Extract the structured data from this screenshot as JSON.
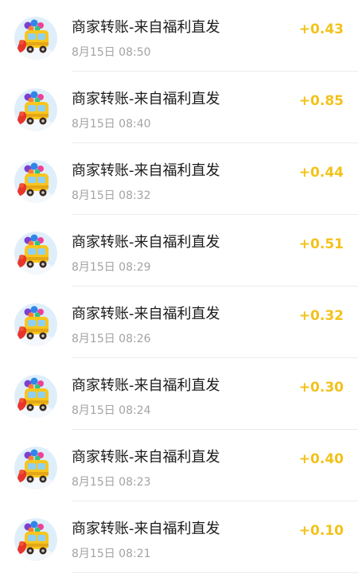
{
  "colors": {
    "amount": "#f2c21b",
    "title": "#1a1a1a",
    "time": "#a3a3a3",
    "divider": "#ececec"
  },
  "transactions": [
    {
      "avatar_icon": "toy-truck-avatar-icon",
      "title": "商家转账-来自福利直发",
      "time": "8月15日 08:50",
      "amount": "+0.43"
    },
    {
      "avatar_icon": "toy-truck-avatar-icon",
      "title": "商家转账-来自福利直发",
      "time": "8月15日 08:40",
      "amount": "+0.85"
    },
    {
      "avatar_icon": "toy-truck-avatar-icon",
      "title": "商家转账-来自福利直发",
      "time": "8月15日 08:32",
      "amount": "+0.44"
    },
    {
      "avatar_icon": "toy-truck-avatar-icon",
      "title": "商家转账-来自福利直发",
      "time": "8月15日 08:29",
      "amount": "+0.51"
    },
    {
      "avatar_icon": "toy-truck-avatar-icon",
      "title": "商家转账-来自福利直发",
      "time": "8月15日 08:26",
      "amount": "+0.32"
    },
    {
      "avatar_icon": "toy-truck-avatar-icon",
      "title": "商家转账-来自福利直发",
      "time": "8月15日 08:24",
      "amount": "+0.30"
    },
    {
      "avatar_icon": "toy-truck-avatar-icon",
      "title": "商家转账-来自福利直发",
      "time": "8月15日 08:23",
      "amount": "+0.40"
    },
    {
      "avatar_icon": "toy-truck-avatar-icon",
      "title": "商家转账-来自福利直发",
      "time": "8月15日 08:21",
      "amount": "+0.10"
    }
  ]
}
